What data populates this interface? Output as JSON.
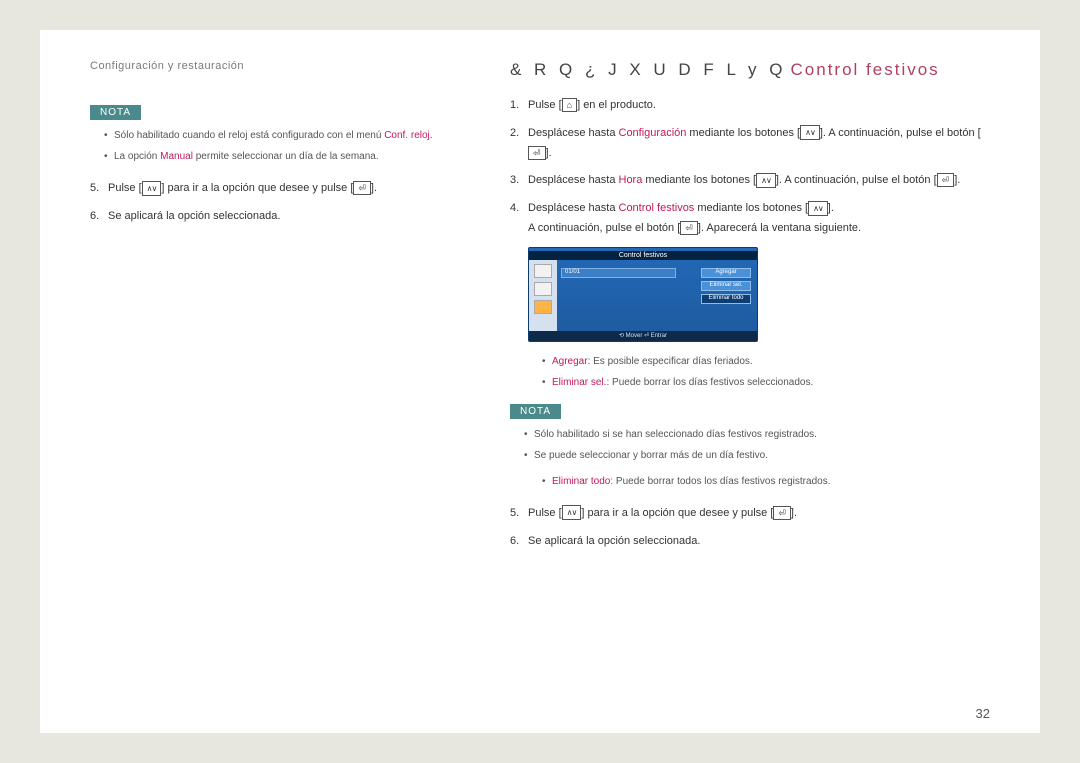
{
  "header": "Configuración y restauración",
  "pageNumber": "32",
  "left": {
    "notaLabel": "NOTA",
    "bullets": [
      {
        "pre": "Sólo habilitado cuando el reloj está configurado con el menú ",
        "hl": "Conf. reloj",
        "post": "."
      },
      {
        "pre": "La opción ",
        "hl": "Manual",
        "post": " permite seleccionar un día de la semana."
      }
    ],
    "step5": {
      "pre": "Pulse [",
      "mid": "] para ir a la opción que desee y pulse [",
      "post": "]."
    },
    "step6": "Se aplicará la opción seleccionada."
  },
  "right": {
    "title": {
      "garble": "& R Q ¿ J X U D F L y Q",
      "main": "Control festivos"
    },
    "steps": {
      "s1": {
        "pre": "Pulse [",
        "post": "] en el producto."
      },
      "s2": {
        "pre": "Desplácese hasta ",
        "hl": "Configuración",
        "mid": " mediante los botones [",
        "mid2": "]. A continuación, pulse el botón [",
        "post": "]."
      },
      "s3": {
        "pre": "Desplácese hasta ",
        "hl": "Hora",
        "mid": " mediante los botones [",
        "mid2": "]. A continuación, pulse el botón [",
        "post": "]."
      },
      "s4": {
        "pre": "Desplácese hasta ",
        "hl": "Control festivos",
        "mid": " mediante los botones [",
        "mid2": "].",
        "line2pre": "A continuación, pulse el botón [",
        "line2post": "]. Aparecerá la ventana siguiente."
      }
    },
    "screenshot": {
      "title": "Control festivos",
      "row": "01/01",
      "btn1": "Agregar",
      "btn2": "Eliminar sel.",
      "btn3": "Eliminar todo",
      "footer": "⟲ Mover   ⏎ Entrar"
    },
    "opts": {
      "agregar": {
        "hl": "Agregar",
        "post": ": Es posible especificar días feriados."
      },
      "elimsel": {
        "hl": "Eliminar sel.",
        "post": ": Puede borrar los días festivos seleccionados."
      }
    },
    "notaLabel": "NOTA",
    "notaBullets": [
      "Sólo habilitado si se han seleccionado días festivos registrados.",
      "Se puede seleccionar y borrar más de un día festivo."
    ],
    "elimtodo": {
      "hl": "Eliminar todo",
      "post": ": Puede borrar todos los días festivos registrados."
    },
    "step5": {
      "pre": "Pulse [",
      "mid": "] para ir a la opción que desee y pulse [",
      "post": "]."
    },
    "step6": "Se aplicará la opción seleccionada."
  }
}
